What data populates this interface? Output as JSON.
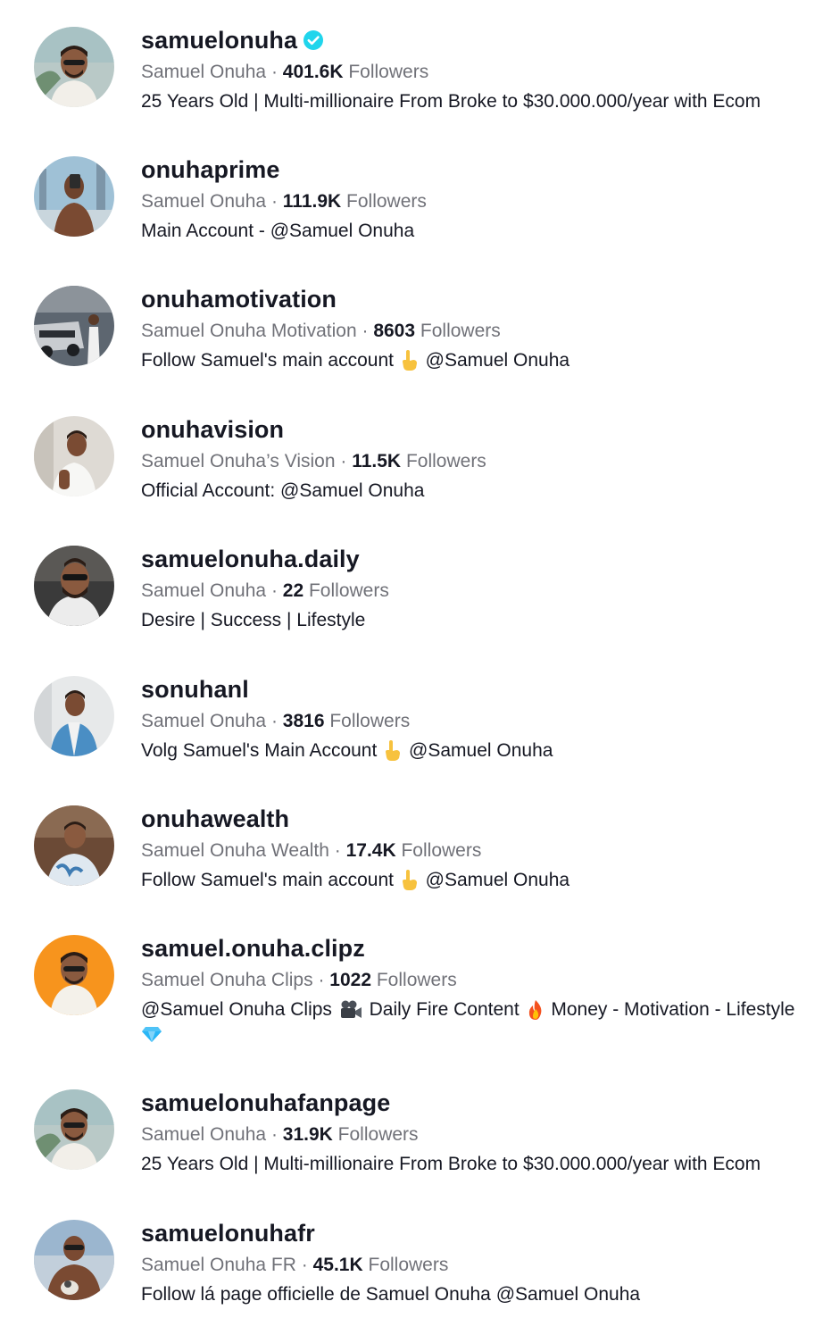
{
  "accounts": [
    {
      "username": "samuelonuha",
      "verified": true,
      "display_name": "Samuel Onuha",
      "followers_count": "401.6K",
      "followers_label": "Followers",
      "bio": "25 Years Old | Multi-millionaire From Broke to $30.000.000/year with Ecom",
      "avatar_bg": "#b9c9c7"
    },
    {
      "username": "onuhaprime",
      "verified": false,
      "display_name": "Samuel Onuha",
      "followers_count": "111.9K",
      "followers_label": "Followers",
      "bio": "Main Account - @Samuel Onuha",
      "avatar_bg": "#8fb2c9"
    },
    {
      "username": "onuhamotivation",
      "verified": false,
      "display_name": "Samuel Onuha Motivation",
      "followers_count": "8603",
      "followers_label": "Followers",
      "bio_before": "Follow Samuel's main account",
      "bio_emoji": "pointing-down-emoji",
      "bio_after": "@Samuel Onuha",
      "avatar_bg": "#5d6670"
    },
    {
      "username": "onuhavision",
      "verified": false,
      "display_name": "Samuel Onuha’s Vision",
      "followers_count": "11.5K",
      "followers_label": "Followers",
      "bio": "Official Account: @Samuel Onuha",
      "avatar_bg": "#d9d6d1"
    },
    {
      "username": "samuelonuha.daily",
      "verified": false,
      "display_name": "Samuel Onuha",
      "followers_count": "22",
      "followers_label": "Followers",
      "bio": "Desire | Success | Lifestyle",
      "avatar_bg": "#3a3a3a"
    },
    {
      "username": "sonuhanl",
      "verified": false,
      "display_name": "Samuel Onuha",
      "followers_count": "3816",
      "followers_label": "Followers",
      "bio_before": "Volg Samuel's Main Account",
      "bio_emoji": "pointing-down-emoji",
      "bio_after": "@Samuel Onuha",
      "avatar_bg": "#e7e9ea"
    },
    {
      "username": "onuhawealth",
      "verified": false,
      "display_name": "Samuel Onuha Wealth",
      "followers_count": "17.4K",
      "followers_label": "Followers",
      "bio_before": "Follow Samuel's main account",
      "bio_emoji": "pointing-down-emoji",
      "bio_after": "@Samuel Onuha",
      "avatar_bg": "#6b4a36"
    },
    {
      "username": "samuel.onuha.clipz",
      "verified": false,
      "display_name": "Samuel Onuha Clips",
      "followers_count": "1022",
      "followers_label": "Followers",
      "bio_part1": "@Samuel Onuha Clips",
      "bio_part2": "Daily Fire Content",
      "bio_part3": "Money - Motivation - Lifestyle",
      "avatar_bg": "#f7941d"
    },
    {
      "username": "samuelonuhafanpage",
      "verified": false,
      "display_name": "Samuel Onuha",
      "followers_count": "31.9K",
      "followers_label": "Followers",
      "bio": "25 Years Old | Multi-millionaire From Broke to $30.000.000/year with Ecom",
      "avatar_bg": "#b9c9c7"
    },
    {
      "username": "samuelonuhafr",
      "verified": false,
      "display_name": "Samuel Onuha FR",
      "followers_count": "45.1K",
      "followers_label": "Followers",
      "bio": "Follow lá page officielle de Samuel Onuha @Samuel Onuha",
      "avatar_bg": "#9bb6cf"
    }
  ],
  "separator": "·",
  "colors": {
    "primary_text": "#161823",
    "secondary_text": "#73747b",
    "verified_badge": "#20d5ec"
  }
}
